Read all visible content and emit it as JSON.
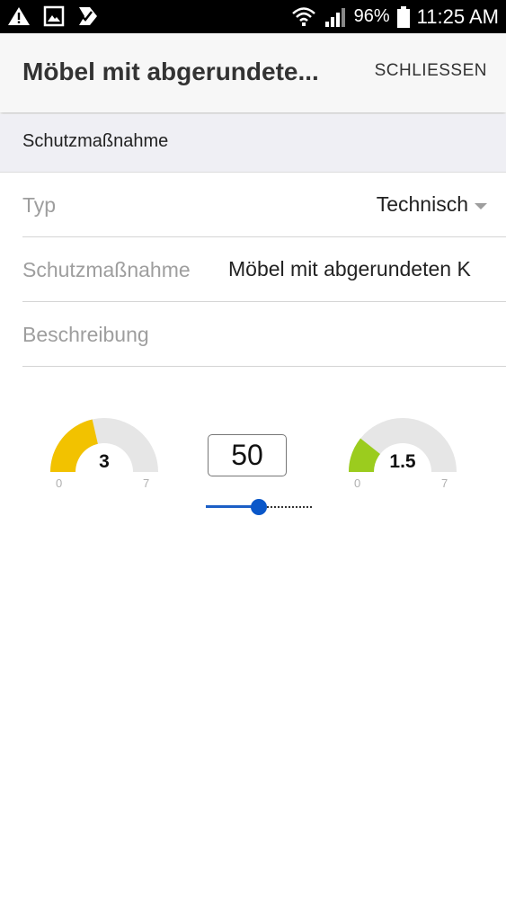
{
  "status_bar": {
    "left_icons": [
      "warning-icon",
      "image-icon",
      "check-badge-icon"
    ],
    "battery": "96%",
    "time": "11:25 AM"
  },
  "app_bar": {
    "title": "Möbel mit abgerundete...",
    "action": "SCHLIESSEN"
  },
  "section": {
    "title": "Schutzmaßnahme"
  },
  "form": {
    "typ": {
      "label": "Typ",
      "value": "Technisch"
    },
    "schutzmassnahme": {
      "label": "Schutzmaßnahme",
      "value": "Möbel mit abgerundeten K"
    },
    "beschreibung": {
      "label": "Beschreibung",
      "value": ""
    }
  },
  "gauges": {
    "left": {
      "value": 3,
      "value_text": "3",
      "min": "0",
      "max": "7",
      "color": "#f2c200"
    },
    "right": {
      "value": 1.5,
      "value_text": "1.5",
      "min": "0",
      "max": "7",
      "color": "#9bcc1e"
    }
  },
  "number_input": {
    "value": "50"
  },
  "slider": {
    "value": 50,
    "min": 0,
    "max": 100,
    "color": "#0a57c9"
  }
}
